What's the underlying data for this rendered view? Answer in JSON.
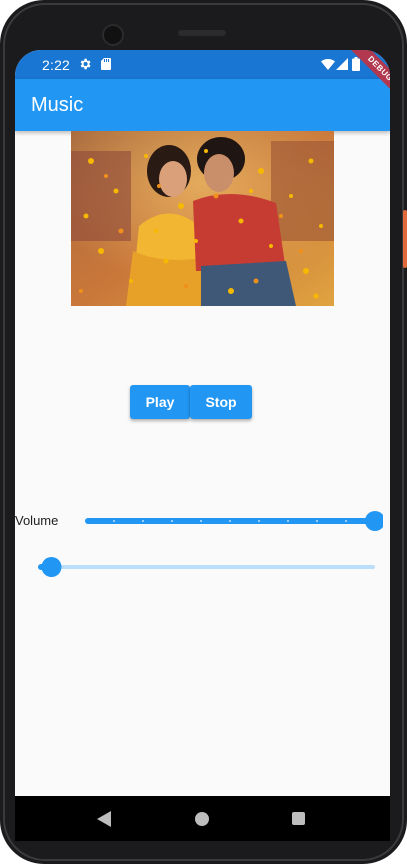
{
  "status_bar": {
    "time": "2:22",
    "icons": [
      "gear-icon",
      "sd-card-icon",
      "wifi-icon",
      "signal-icon",
      "battery-icon"
    ]
  },
  "debug_banner": "DEBUG",
  "app_bar": {
    "title": "Music"
  },
  "album_art": {
    "description_icon": "album-art-image"
  },
  "controls": {
    "play_label": "Play",
    "stop_label": "Stop"
  },
  "volume": {
    "label": "Volume",
    "value": 1.0,
    "divisions": 10
  },
  "seek": {
    "value": 0.04
  },
  "navigation": {
    "icons": [
      "back-icon",
      "home-icon",
      "recents-icon"
    ]
  },
  "colors": {
    "primary": "#2196f3",
    "primary_dark": "#1976d2",
    "slider_inactive": "#bbdefb",
    "background": "#fafafa"
  }
}
